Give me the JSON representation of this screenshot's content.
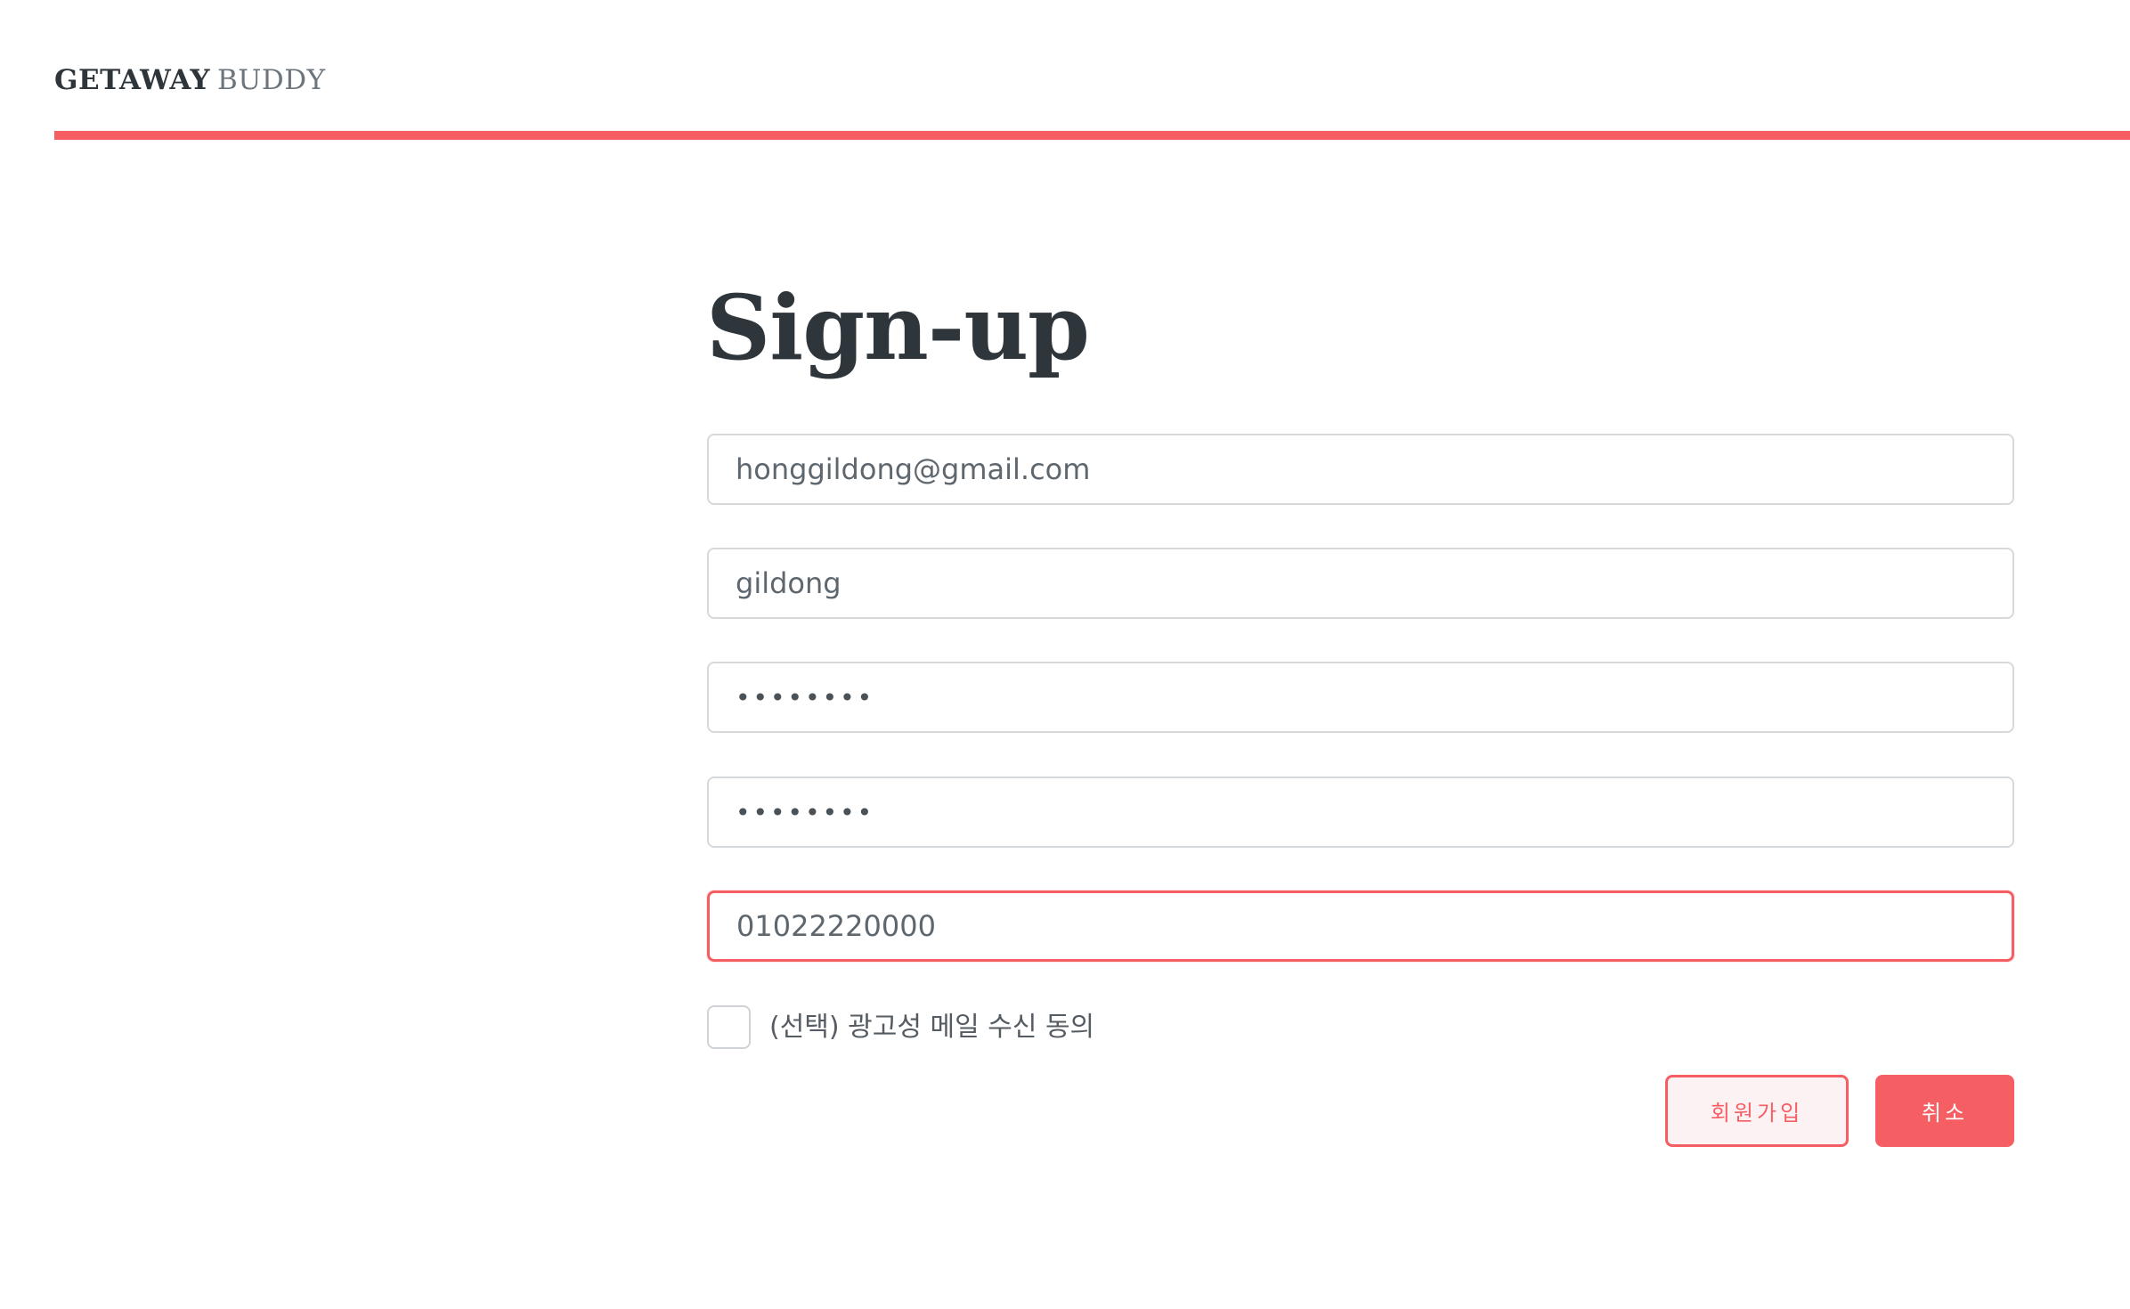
{
  "header": {
    "brand_primary": "GETAWAY",
    "brand_secondary": "BUDDY",
    "accent_color": "#f55f63"
  },
  "main": {
    "title": "Sign-up",
    "fields": {
      "email": "honggildong@gmail.com",
      "nickname": "gildong",
      "password": "••••••••",
      "password_confirm": "••••••••",
      "phone": "01022220000"
    },
    "marketing_consent": {
      "label": "(선택) 광고성 메일 수신 동의",
      "checked": false
    },
    "buttons": {
      "signup_label": "회원가입",
      "cancel_label": "취소"
    }
  }
}
